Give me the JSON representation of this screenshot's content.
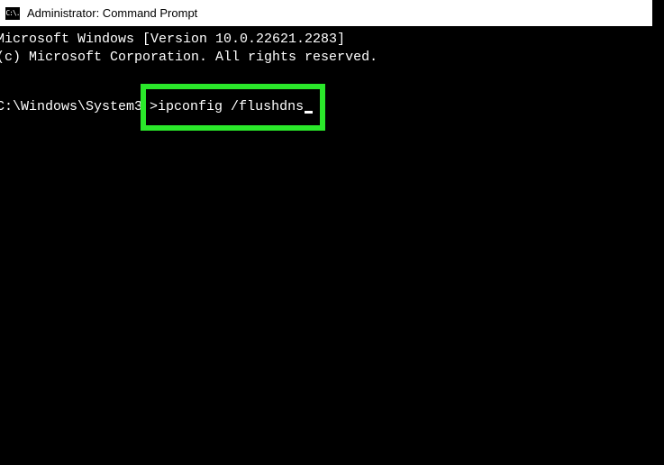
{
  "titlebar": {
    "icon_text": "C:\\.",
    "title": "Administrator: Command Prompt"
  },
  "terminal": {
    "line1": "Microsoft Windows [Version 10.0.22621.2283]",
    "line2": "(c) Microsoft Corporation. All rights reserved.",
    "prompt_prefix": "C:\\Windows\\System3",
    "prompt_char": ">",
    "command": "ipconfig /flushdns"
  },
  "highlight": {
    "color": "#2ae82a"
  }
}
